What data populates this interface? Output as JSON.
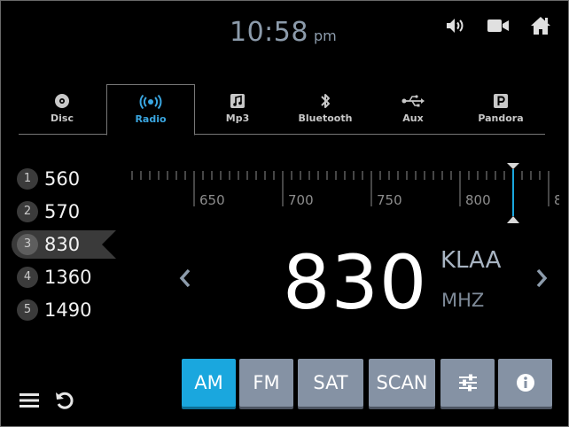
{
  "header": {
    "time": "10:58",
    "ampm": "pm",
    "icons": [
      "volume-icon",
      "video-camera-icon",
      "home-icon"
    ]
  },
  "tabs": [
    {
      "label": "Disc",
      "icon": "disc-icon",
      "active": false
    },
    {
      "label": "Radio",
      "icon": "radio-broadcast-icon",
      "active": true
    },
    {
      "label": "Mp3",
      "icon": "music-file-icon",
      "active": false
    },
    {
      "label": "Bluetooth",
      "icon": "bluetooth-icon",
      "active": false
    },
    {
      "label": "Aux",
      "icon": "usb-icon",
      "active": false
    },
    {
      "label": "Pandora",
      "icon": "pandora-icon",
      "active": false
    }
  ],
  "presets": [
    {
      "num": "1",
      "freq": "560",
      "active": false
    },
    {
      "num": "2",
      "freq": "570",
      "active": false
    },
    {
      "num": "3",
      "freq": "830",
      "active": true
    },
    {
      "num": "4",
      "freq": "1360",
      "active": false
    },
    {
      "num": "5",
      "freq": "1490",
      "active": false
    }
  ],
  "tuner": {
    "labels": [
      "650",
      "700",
      "750",
      "800",
      "8"
    ],
    "current": 830
  },
  "display": {
    "frequency": "830",
    "station": "KLAA",
    "unit": "MHZ"
  },
  "buttons": [
    {
      "label": "AM",
      "active": true
    },
    {
      "label": "FM",
      "active": false
    },
    {
      "label": "SAT",
      "active": false
    },
    {
      "label": "SCAN",
      "active": false
    },
    {
      "label": "",
      "icon": "sliders-icon",
      "active": false
    },
    {
      "label": "",
      "icon": "info-icon",
      "active": false
    }
  ],
  "footer": {
    "icons": [
      "menu-icon",
      "back-icon"
    ]
  },
  "colors": {
    "accent": "#1aa7de",
    "tab_active": "#3aa6e0",
    "button": "#8592a4",
    "text_muted": "#8c9bab"
  }
}
